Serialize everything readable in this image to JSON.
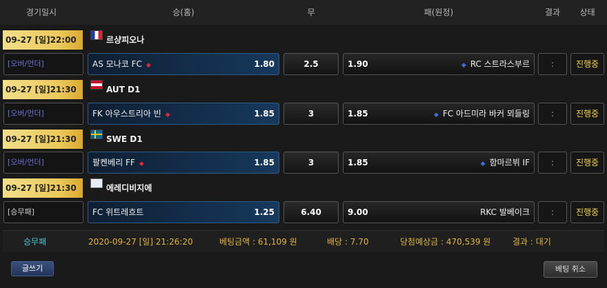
{
  "header": {
    "date_col": "경기일시",
    "home_col": "승(홈)",
    "draw_col": "무",
    "away_col": "패(원정)",
    "result_col": "결과",
    "status_col": "상태"
  },
  "matches": [
    {
      "datetime": "09-27 [일]22:00",
      "league": "르샹피오나",
      "flag": "fr-flag-icon",
      "bet_type": "[오버/언더]",
      "home": "AS 모나코 FC",
      "home_odds": "1.80",
      "draw": "2.5",
      "away_odds": "1.90",
      "away": "RC 스트라스부르",
      "result": ":",
      "status": "진행중"
    },
    {
      "datetime": "09-27 [일]21:30",
      "league": "AUT D1",
      "flag": "at-flag-icon",
      "bet_type": "[오버/언더]",
      "home": "FK 아우스트리아 빈",
      "home_odds": "1.85",
      "draw": "3",
      "away_odds": "1.85",
      "away": "FC 아드미라 바커 뫼들링",
      "result": ":",
      "status": "진행중"
    },
    {
      "datetime": "09-27 [일]21:30",
      "league": "SWE D1",
      "flag": "se-flag-icon",
      "bet_type": "[오버/언더]",
      "home": "팔켄베리 FF",
      "home_odds": "1.85",
      "draw": "3",
      "away_odds": "1.85",
      "away": "함마르뷔 IF",
      "result": ":",
      "status": "진행중"
    },
    {
      "datetime": "09-27 [일]21:30",
      "league": "에레디비지에",
      "flag": "nl-league-icon",
      "bet_type": "[승무패]",
      "home": "FC 위트레흐트",
      "home_odds": "1.25",
      "draw": "6.40",
      "away_odds": "9.00",
      "away": "RKC 발베이크",
      "result": ":",
      "status": "진행중"
    }
  ],
  "summary": {
    "type": "승무패",
    "datetime": "2020-09-27 [일] 21:26:20",
    "amount": "베팅금액 : 61,109 원",
    "odds": "배당 : 7.70",
    "expected": "당첨예상금 : 470,539 원",
    "result": "결과 : 대기"
  },
  "buttons": {
    "write": "글쓰기",
    "cancel": "베팅 취소"
  },
  "colors": {
    "status_text": "#f4d34a",
    "summary_text": "#e0b53e",
    "summary_type": "#4ec7d8",
    "type_button_text": "#6f6fd9",
    "home_accent": "#16395c"
  }
}
